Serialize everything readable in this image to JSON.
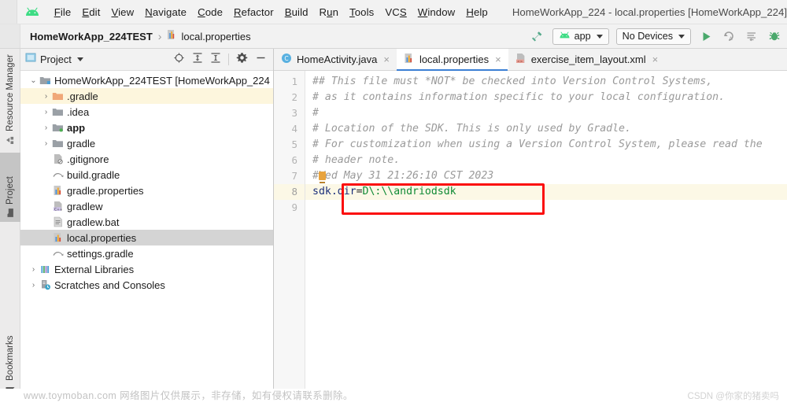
{
  "window": {
    "title": "HomeWorkApp_224 - local.properties [HomeWorkApp_224]",
    "app_logo_icon": "android-logo-icon"
  },
  "menubar": {
    "items": [
      {
        "label": "File",
        "mnemonic": "F"
      },
      {
        "label": "Edit",
        "mnemonic": "E"
      },
      {
        "label": "View",
        "mnemonic": "V"
      },
      {
        "label": "Navigate",
        "mnemonic": "N"
      },
      {
        "label": "Code",
        "mnemonic": "C"
      },
      {
        "label": "Refactor",
        "mnemonic": "R"
      },
      {
        "label": "Build",
        "mnemonic": "B"
      },
      {
        "label": "Run",
        "mnemonic": "u"
      },
      {
        "label": "Tools",
        "mnemonic": "T"
      },
      {
        "label": "VCS",
        "mnemonic": "S"
      },
      {
        "label": "Window",
        "mnemonic": "W"
      },
      {
        "label": "Help",
        "mnemonic": "H"
      }
    ]
  },
  "toolbar": {
    "breadcrumb_root": "HomeWorkApp_224TEST",
    "breadcrumb_separator": "›",
    "breadcrumb_file": "local.properties",
    "breadcrumb_file_icon": "properties-file-icon",
    "make_project_icon": "hammer-icon",
    "run_config": "app",
    "run_config_icon": "android-icon",
    "device_selector": "No Devices",
    "run_icon": "run-play-icon",
    "rerun_icon": "apply-changes-icon",
    "logcat_icon": "logcat-icon",
    "debug_icon": "debug-bug-icon"
  },
  "left_strip": {
    "tabs": [
      {
        "label": "Resource Manager",
        "icon": "resource-manager-icon",
        "selected": false
      },
      {
        "label": "Project",
        "icon": "project-folder-icon",
        "selected": true
      },
      {
        "label": "Bookmarks",
        "icon": "bookmark-icon",
        "selected": false
      }
    ]
  },
  "project_panel": {
    "title": "Project",
    "title_icon": "project-view-icon",
    "header_icons": [
      "locate-target-icon",
      "expand-all-icon",
      "collapse-all-icon",
      "gear-icon",
      "minimize-icon"
    ],
    "tree": [
      {
        "label": "HomeWorkApp_224TEST [HomeWorkApp_224",
        "indent": 0,
        "arrow": "⌄",
        "icon": "module-folder-icon",
        "bold_from": 21,
        "highlight": "none"
      },
      {
        "label": ".gradle",
        "indent": 1,
        "arrow": "›",
        "icon": "gradle-folder-icon",
        "highlight": "yellow"
      },
      {
        "label": ".idea",
        "indent": 1,
        "arrow": "›",
        "icon": "folder-icon",
        "highlight": "none"
      },
      {
        "label": "app",
        "indent": 1,
        "arrow": "›",
        "icon": "module-folder-icon",
        "bold": true,
        "highlight": "none"
      },
      {
        "label": "gradle",
        "indent": 1,
        "arrow": "›",
        "icon": "folder-icon",
        "highlight": "none"
      },
      {
        "label": ".gitignore",
        "indent": 1,
        "arrow": "",
        "icon": "gitignore-file-icon",
        "highlight": "none"
      },
      {
        "label": "build.gradle",
        "indent": 1,
        "arrow": "",
        "icon": "gradle-file-icon",
        "highlight": "none"
      },
      {
        "label": "gradle.properties",
        "indent": 1,
        "arrow": "",
        "icon": "properties-file-icon",
        "highlight": "none"
      },
      {
        "label": "gradlew",
        "indent": 1,
        "arrow": "",
        "icon": "cpp-file-icon",
        "highlight": "none"
      },
      {
        "label": "gradlew.bat",
        "indent": 1,
        "arrow": "",
        "icon": "text-file-icon",
        "highlight": "none"
      },
      {
        "label": "local.properties",
        "indent": 1,
        "arrow": "",
        "icon": "properties-file-icon",
        "highlight": "gray"
      },
      {
        "label": "settings.gradle",
        "indent": 1,
        "arrow": "",
        "icon": "gradle-file-icon",
        "highlight": "none"
      },
      {
        "label": "External Libraries",
        "indent": 0,
        "arrow": "›",
        "icon": "library-icon",
        "highlight": "none"
      },
      {
        "label": "Scratches and Consoles",
        "indent": 0,
        "arrow": "›",
        "icon": "scratches-icon",
        "highlight": "none"
      }
    ]
  },
  "editor": {
    "tabs": [
      {
        "label": "HomeActivity.java",
        "icon": "java-class-icon",
        "active": false,
        "close": "×"
      },
      {
        "label": "local.properties",
        "icon": "properties-file-icon",
        "active": true,
        "close": "×"
      },
      {
        "label": "exercise_item_layout.xml",
        "icon": "xml-layout-icon",
        "active": false,
        "close": "×"
      }
    ],
    "line_numbers": [
      "1",
      "2",
      "3",
      "4",
      "5",
      "6",
      "7",
      "8",
      "9"
    ],
    "current_line": 8,
    "lines": [
      {
        "n": 1,
        "type": "comment",
        "text": "## This file must *NOT* be checked into Version Control Systems,"
      },
      {
        "n": 2,
        "type": "comment",
        "text": "# as it contains information specific to your local configuration."
      },
      {
        "n": 3,
        "type": "comment",
        "text": "#"
      },
      {
        "n": 4,
        "type": "comment",
        "text": "# Location of the SDK. This is only used by Gradle."
      },
      {
        "n": 5,
        "type": "comment",
        "text": "# For customization when using a Version Control System, please read the"
      },
      {
        "n": 6,
        "type": "comment",
        "text": "# header note."
      },
      {
        "n": 7,
        "type": "comment",
        "text": "#Wed May 31 21:26:10 CST 2023"
      },
      {
        "n": 8,
        "type": "property",
        "key": "sdk.dir",
        "eq": "=",
        "value": "D\\:\\\\andriodsdk",
        "full": "sdk.dir=D\\:\\\\andriodsdk"
      },
      {
        "n": 9,
        "type": "blank",
        "text": ""
      }
    ],
    "annotation": {
      "shape": "red-rectangle",
      "color": "#fb0d0d",
      "targets_line": 8
    },
    "caret_marker": {
      "line": 7,
      "color": "#e8a33d"
    }
  },
  "watermarks": {
    "left": "www.toymoban.com 网络图片仅供展示，非存储，如有侵权请联系删除。",
    "right": "CSDN @你家的猪卖吗"
  },
  "colors": {
    "accent_blue": "#3b7fd4",
    "android_green": "#3ddc84",
    "annotation_red": "#fb0d0d",
    "comment_gray": "#9a9a9a",
    "value_green": "#0f8a35",
    "key_navy": "#1a2e7a",
    "selection_gray": "#d4d4d4",
    "highlight_yellow": "#fdf6dd"
  }
}
